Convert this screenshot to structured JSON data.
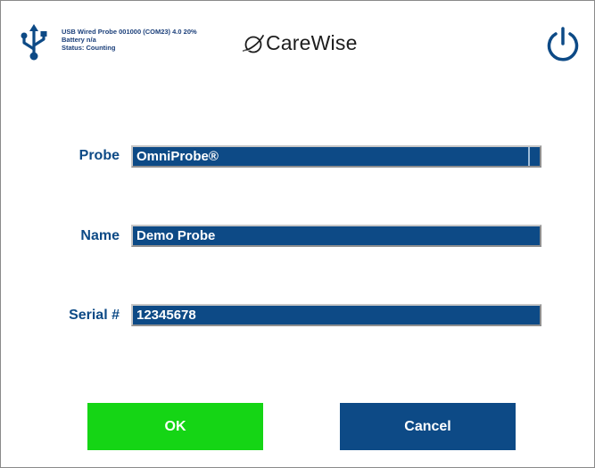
{
  "header": {
    "device_line": "USB Wired Probe 001000 (COM23) 4.0 20%",
    "battery_line": "Battery n/a",
    "status_line": "Status: Counting",
    "logo_text": "CareWise",
    "usb_icon": "usb-icon",
    "power_icon": "power-icon"
  },
  "form": {
    "probe": {
      "label": "Probe",
      "value": "OmniProbe®"
    },
    "name": {
      "label": "Name",
      "value": "Demo Probe"
    },
    "serial": {
      "label": "Serial #",
      "value": "12345678"
    }
  },
  "buttons": {
    "ok": "OK",
    "cancel": "Cancel"
  },
  "colors": {
    "accent": "#0d4a86",
    "ok": "#15d515",
    "label": "#0d4a86"
  }
}
